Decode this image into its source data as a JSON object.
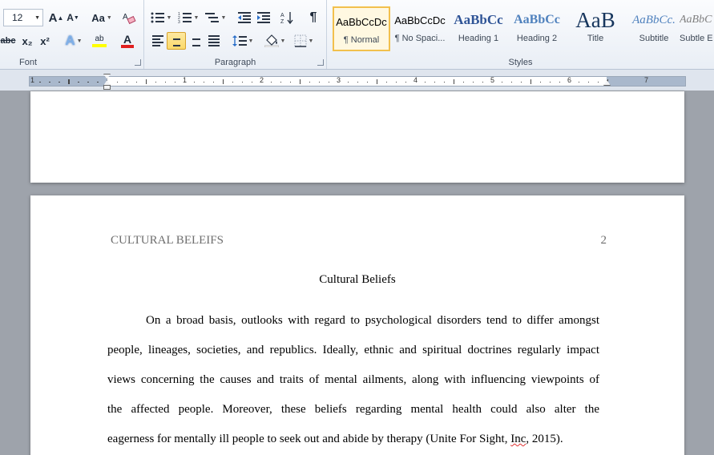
{
  "ribbon": {
    "font_group": {
      "label": "Font",
      "font_size": "12"
    },
    "paragraph_group": {
      "label": "Paragraph"
    },
    "styles_group": {
      "label": "Styles",
      "styles": [
        {
          "sample": "AaBbCcDc",
          "name": "¶ Normal"
        },
        {
          "sample": "AaBbCcDc",
          "name": "¶ No Spaci..."
        },
        {
          "sample": "AaBbCc",
          "name": "Heading 1"
        },
        {
          "sample": "AaBbCc",
          "name": "Heading 2"
        },
        {
          "sample": "AaB",
          "name": "Title"
        },
        {
          "sample": "AaBbCc.",
          "name": "Subtitle"
        },
        {
          "sample": "AaBbC",
          "name": "Subtle E"
        }
      ]
    },
    "icons": {
      "grow_font": "A",
      "shrink_font": "A",
      "change_case": "Aa",
      "strikethrough": "abc",
      "subscript": "x₂",
      "superscript": "x²",
      "text_effects": "A",
      "highlight": "ab",
      "font_color": "A",
      "pilcrow": "¶"
    }
  },
  "ruler": {
    "numbers": [
      "1",
      "1",
      "2",
      "3",
      "4",
      "5",
      "6",
      "7"
    ]
  },
  "document": {
    "header_title": "CULTURAL BELEIFS",
    "page_number": "2",
    "title": "Cultural Beliefs",
    "paragraph_lines": [
      "On a broad basis, outlooks with regard to psychological  disorders tend to differ amongst",
      "people, lineages, societies, and republics.  Ideally, ethnic and spiritual doctrines regularly impact",
      "views concerning the causes and traits of mental ailments, along with influencing viewpoints of",
      "the affected people. Moreover, these beliefs regarding mental health could also alter the"
    ],
    "last_line_before": "eagerness  for mentally ill people to seek out and abide by therapy (Unite For Sight, ",
    "last_line_flagged": "Inc",
    "last_line_after": ", 2015)."
  },
  "colors": {
    "highlight_yellow": "#ffff00",
    "font_red": "#e02020",
    "selected_style_border": "#f2c04d"
  }
}
